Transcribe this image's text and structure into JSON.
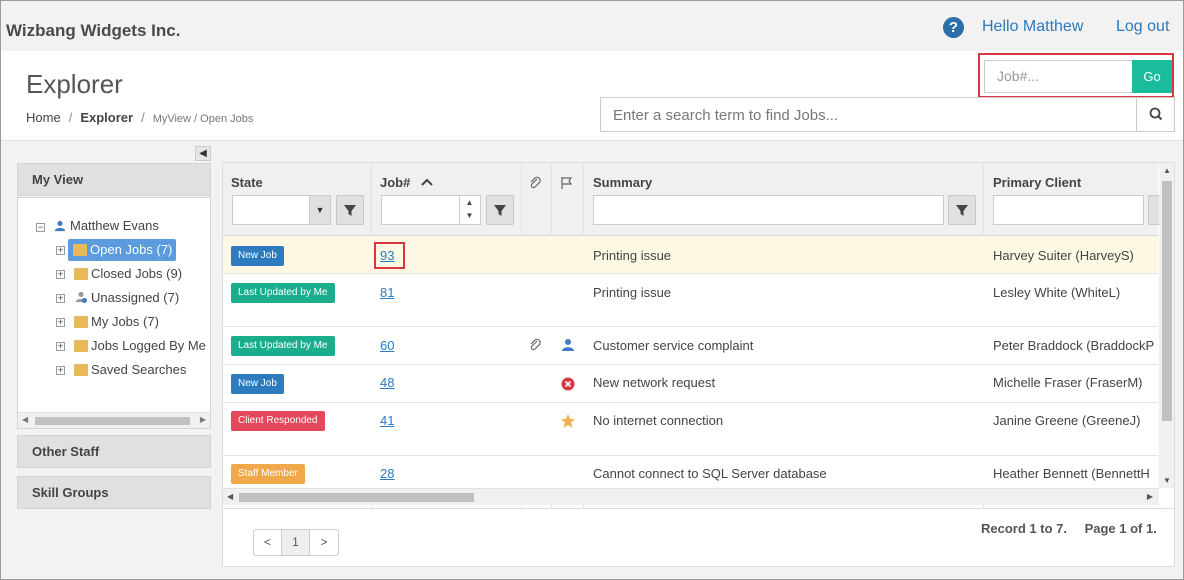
{
  "app": {
    "brand": "Wizbang Widgets Inc.",
    "help_icon": "question-circle-icon",
    "hello": "Hello Matthew",
    "logout": "Log out"
  },
  "header": {
    "title": "Explorer",
    "breadcrumb": [
      "Home",
      "Explorer",
      "MyView / Open Jobs"
    ],
    "job_placeholder": "Job#...",
    "go_label": "Go",
    "search_placeholder": "Enter a search term to find Jobs..."
  },
  "sidebar": {
    "my_view": "My View",
    "tree_root": "Matthew Evans",
    "tree_items": [
      {
        "label": "Open Jobs (7)",
        "selected": true
      },
      {
        "label": "Closed Jobs (9)"
      },
      {
        "label": "Unassigned (7)"
      },
      {
        "label": "My Jobs (7)"
      },
      {
        "label": "Jobs Logged By Me ("
      },
      {
        "label": "Saved Searches"
      }
    ],
    "other_staff": "Other Staff",
    "skill_groups": "Skill Groups"
  },
  "grid": {
    "columns": [
      "State",
      "Job#",
      "",
      "",
      "Summary",
      "Primary Client"
    ],
    "sort_indicator": "^",
    "rows": [
      {
        "state": "New Job",
        "state_color": "#2c7bbf",
        "job": "93",
        "attach": false,
        "flag": "",
        "summary": "Printing issue",
        "client": "Harvey Suiter (HarveyS)",
        "highlight": true
      },
      {
        "state": "Last Updated by Me",
        "state_color": "#1aae8e",
        "job": "81",
        "attach": false,
        "flag": "",
        "summary": "Printing issue",
        "client": "Lesley White (WhiteL)"
      },
      {
        "state": "Last Updated by Me",
        "state_color": "#1aae8e",
        "job": "60",
        "attach": true,
        "flag": "person-icon",
        "summary": "Customer service complaint",
        "client": "Peter Braddock (BraddockP"
      },
      {
        "state": "New Job",
        "state_color": "#2c7bbf",
        "job": "48",
        "attach": false,
        "flag": "x-circle-icon",
        "summary": "New network request",
        "client": "Michelle Fraser (FraserM)"
      },
      {
        "state": "Client Responded",
        "state_color": "#e4485a",
        "job": "41",
        "attach": false,
        "flag": "star-icon",
        "summary": "No internet connection",
        "client": "Janine Greene (GreeneJ)"
      },
      {
        "state": "Staff Member",
        "state_color": "#f0a84a",
        "job": "28",
        "attach": false,
        "flag": "",
        "summary": "Cannot connect to SQL Server database",
        "client": "Heather Bennett (BennettH"
      }
    ]
  },
  "footer": {
    "pager": [
      "<",
      "1",
      ">"
    ],
    "record_info": "Record 1 to 7.",
    "page_info": "Page 1 of 1."
  }
}
